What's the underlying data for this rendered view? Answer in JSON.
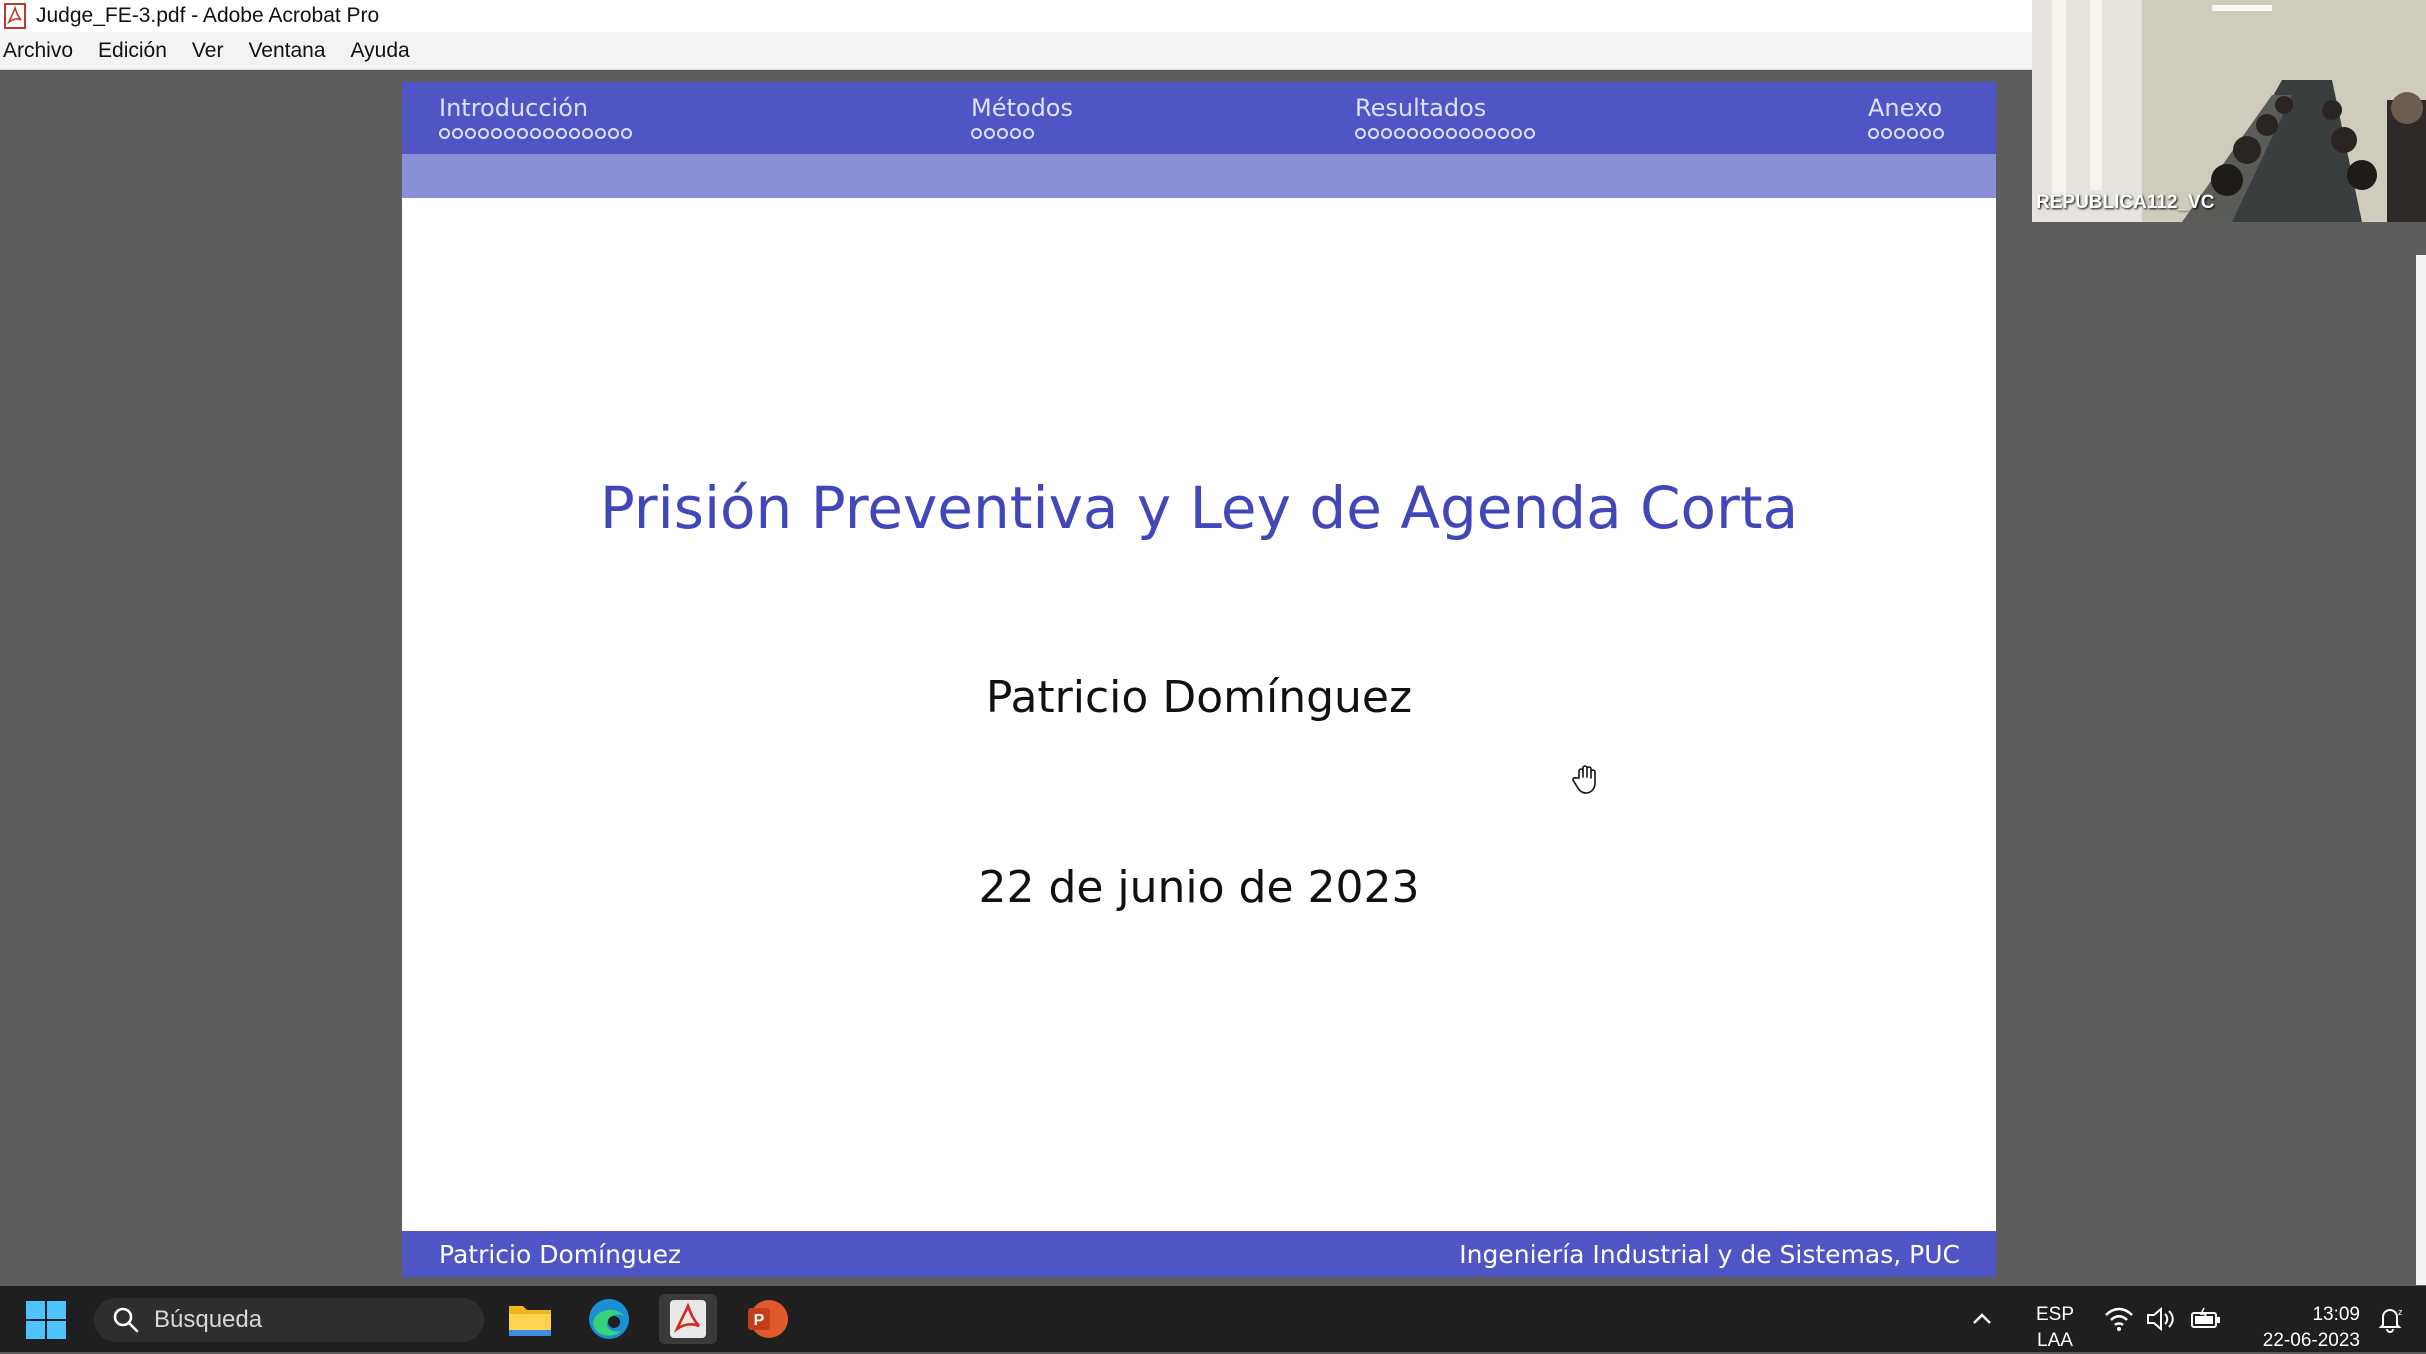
{
  "window": {
    "title": "Judge_FE-3.pdf - Adobe Acrobat Pro"
  },
  "menu": {
    "items": [
      "Archivo",
      "Edición",
      "Ver",
      "Ventana",
      "Ayuda"
    ]
  },
  "slide": {
    "nav": [
      {
        "label": "Introducción",
        "dots": 15
      },
      {
        "label": "Métodos",
        "dots": 5
      },
      {
        "label": "Resultados",
        "dots": 14
      },
      {
        "label": "Anexo",
        "dots": 6
      }
    ],
    "title": "Prisión Preventiva y Ley de Agenda Corta",
    "author": "Patricio Domínguez",
    "date": "22 de junio de 2023",
    "footer_left": "Patricio Domínguez",
    "footer_right": "Ingeniería Industrial y de Sistemas, PUC",
    "accent_color": "#4f55c4"
  },
  "video": {
    "label": "REPUBLICA112_VC"
  },
  "taskbar": {
    "search_placeholder": "Búsqueda",
    "language_top": "ESP",
    "language_bottom": "LAA",
    "time": "13:09",
    "date": "22-06-2023",
    "apps": [
      "file-explorer-icon",
      "edge-icon",
      "acrobat-icon",
      "powerpoint-icon"
    ]
  }
}
